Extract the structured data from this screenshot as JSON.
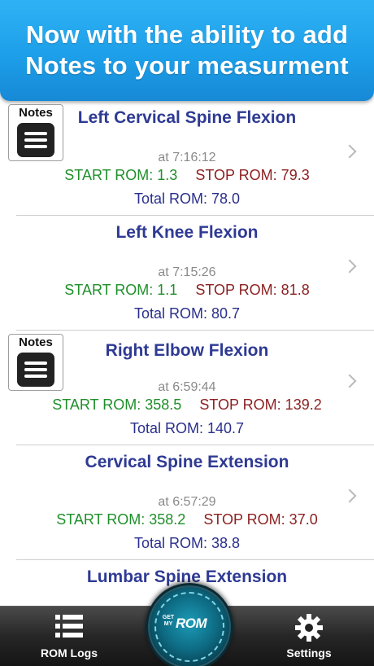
{
  "banner": {
    "line1": "Now with the ability to add",
    "line2": "Notes to your measurment"
  },
  "notes_badge_label": "Notes",
  "logs": [
    {
      "title": "Left Cervical Spine Flexion",
      "time": "at 7:16:12",
      "start": "START ROM: 1.3",
      "stop": "STOP ROM: 79.3",
      "total": "Total ROM: 78.0",
      "has_notes": true
    },
    {
      "title": "Left Knee Flexion",
      "time": "at 7:15:26",
      "start": "START ROM: 1.1",
      "stop": "STOP ROM: 81.8",
      "total": "Total ROM: 80.7",
      "has_notes": false
    },
    {
      "title": "Right Elbow Flexion",
      "time": "at 6:59:44",
      "start": "START ROM: 358.5",
      "stop": "STOP ROM: 139.2",
      "total": "Total ROM: 140.7",
      "has_notes": true
    },
    {
      "title": "Cervical Spine Extension",
      "time": "at 6:57:29",
      "start": "START ROM: 358.2",
      "stop": "STOP ROM: 37.0",
      "total": "Total ROM: 38.8",
      "has_notes": false
    },
    {
      "title": "Lumbar Spine Extension",
      "time": "",
      "start": "",
      "stop": "",
      "total": "",
      "has_notes": false
    }
  ],
  "tab_bar": {
    "rom_logs_label": "ROM Logs",
    "settings_label": "Settings",
    "center_brand_small": "GET MY",
    "center_brand_big": "ROM"
  },
  "colors": {
    "banner": "#1d9fe9",
    "title": "#2e3a93",
    "start": "#1f8f2a",
    "stop": "#8c1f1f",
    "total": "#2a2f8c"
  }
}
